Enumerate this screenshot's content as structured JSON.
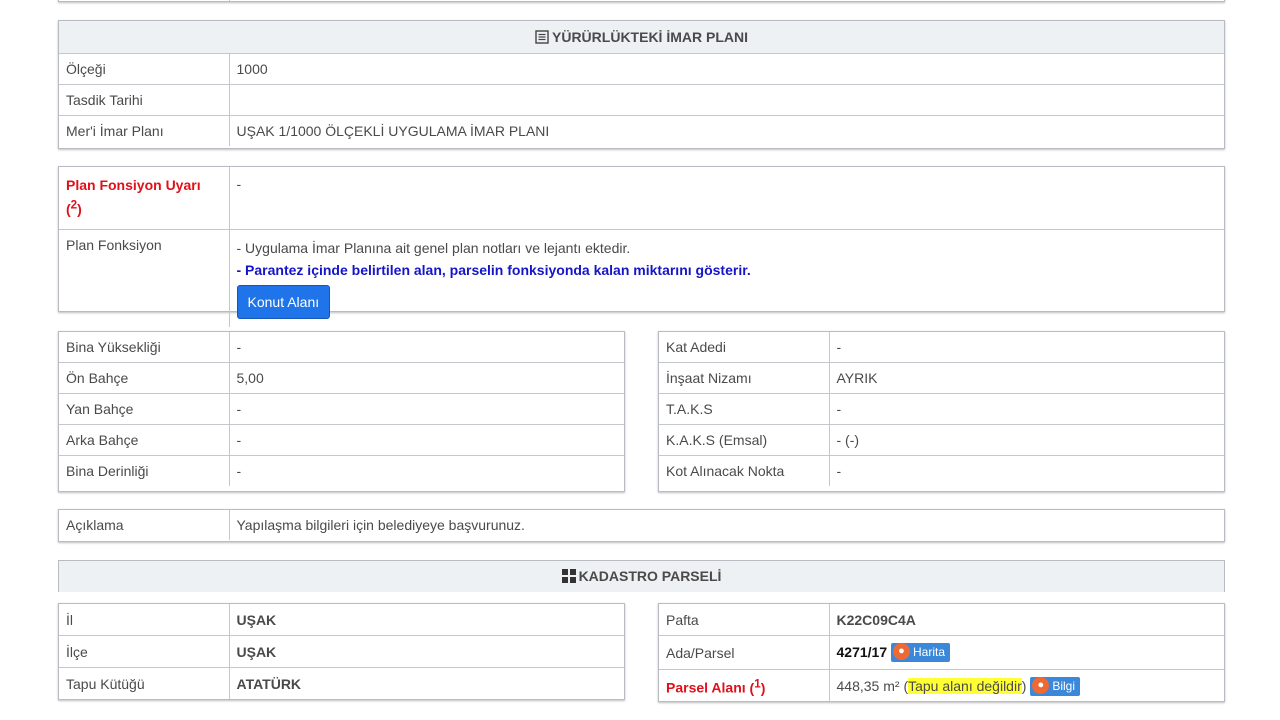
{
  "imar": {
    "header": "YÜRÜRLÜKTEKİ İMAR PLANI",
    "rows": [
      {
        "label": "Ölçeği",
        "value": "1000"
      },
      {
        "label": "Tasdik Tarihi",
        "value": ""
      },
      {
        "label": "Mer'i İmar Planı",
        "value": "UŞAK 1/1000 ÖLÇEKLİ UYGULAMA İMAR PLANI"
      }
    ]
  },
  "fonksiyon": {
    "warning_label": "Plan Fonsiyon Uyarı",
    "warning_sup": "2",
    "warning_value": "-",
    "label": "Plan Fonksiyon",
    "note1": "- Uygulama İmar Planına ait genel plan notları ve lejantı ektedir.",
    "note2": "- Parantez içinde belirtilen alan, parselin fonksiyonda kalan miktarını gösterir.",
    "button": "Konut Alanı"
  },
  "yapi_left": [
    {
      "label": "Bina Yüksekliği",
      "value": "-"
    },
    {
      "label": "Ön Bahçe",
      "value": "5,00"
    },
    {
      "label": "Yan Bahçe",
      "value": "-"
    },
    {
      "label": "Arka Bahçe",
      "value": "-"
    },
    {
      "label": "Bina Derinliği",
      "value": "-"
    }
  ],
  "yapi_right": [
    {
      "label": "Kat Adedi",
      "value": "-"
    },
    {
      "label": "İnşaat Nizamı",
      "value": "AYRIK"
    },
    {
      "label": "T.A.K.S",
      "value": "-"
    },
    {
      "label": "K.A.K.S (Emsal)",
      "value": "- (-)"
    },
    {
      "label": "Kot Alınacak Nokta",
      "value": "-"
    }
  ],
  "aciklama": {
    "label": "Açıklama",
    "value": "Yapılaşma bilgileri için belediyeye başvurunuz."
  },
  "kadastro": {
    "header": "KADASTRO PARSELİ",
    "left": [
      {
        "label": "İl",
        "value": "UŞAK"
      },
      {
        "label": "İlçe",
        "value": "UŞAK"
      },
      {
        "label": "Tapu Kütüğü",
        "value": "ATATÜRK"
      }
    ],
    "pafta_label": "Pafta",
    "pafta_value": "K22C09C4A",
    "ada_label": "Ada/Parsel",
    "ada_value": "4271/17",
    "harita_badge": "Harita",
    "alan_label": "Parsel Alanı",
    "alan_sup": "1",
    "alan_value": "448,35 m²",
    "alan_paren_open": "(",
    "alan_note": "Tapu alanı değildir",
    "alan_paren_close": ")",
    "bilgi_badge": "Bilgi"
  },
  "icons": {
    "doc": "document-list-icon",
    "grid": "grid-icon",
    "globe": "globe-icon"
  },
  "colors": {
    "header_bg": "#edf1f4",
    "warning_red": "#e0101a",
    "note_blue": "#1414c8",
    "button_blue": "#1e74e8",
    "highlight_yellow": "#ffff33"
  }
}
